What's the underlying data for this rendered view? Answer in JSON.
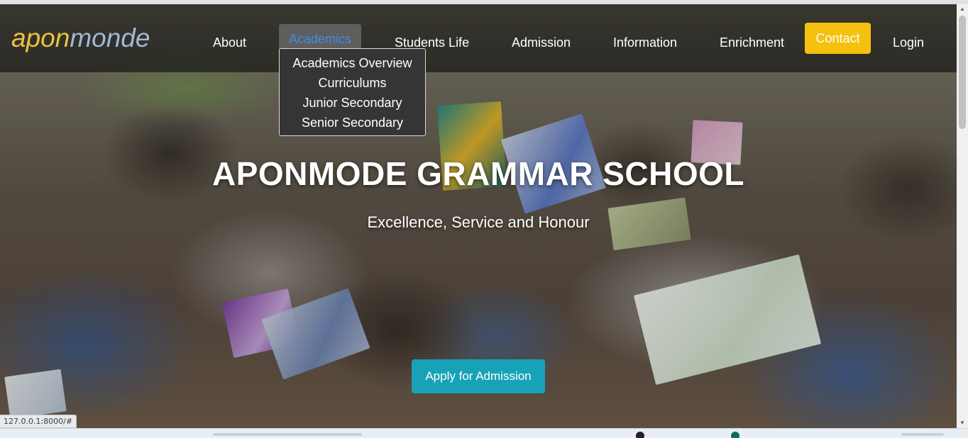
{
  "browser": {
    "status_url": "127.0.0.1:8000/#"
  },
  "navbar": {
    "brand_part1": "apon",
    "brand_part2": "monde",
    "items": {
      "about": "About",
      "academics": "Academics",
      "students_life": "Students Life",
      "admission": "Admission",
      "information": "Information",
      "enrichment": "Enrichment",
      "contact": "Contact",
      "login": "Login"
    },
    "academics_dropdown": [
      "Academics Overview",
      "Curriculums",
      "Junior Secondary",
      "Senior Secondary"
    ]
  },
  "hero": {
    "title": "APONMODE GRAMMAR SCHOOL",
    "subtitle": "Excellence, Service and Honour",
    "cta_label": "Apply for Admission"
  },
  "scrollbar": {
    "up_arrow": "▲",
    "down_arrow": "▼"
  },
  "colors": {
    "brand_gold": "#e9c440",
    "brand_blue": "#9fb9d6",
    "contact_bg": "#f4c10f",
    "active_link": "#3d8ee8",
    "cta_bg": "#17a2b8",
    "dropdown_bg": "#353535"
  }
}
